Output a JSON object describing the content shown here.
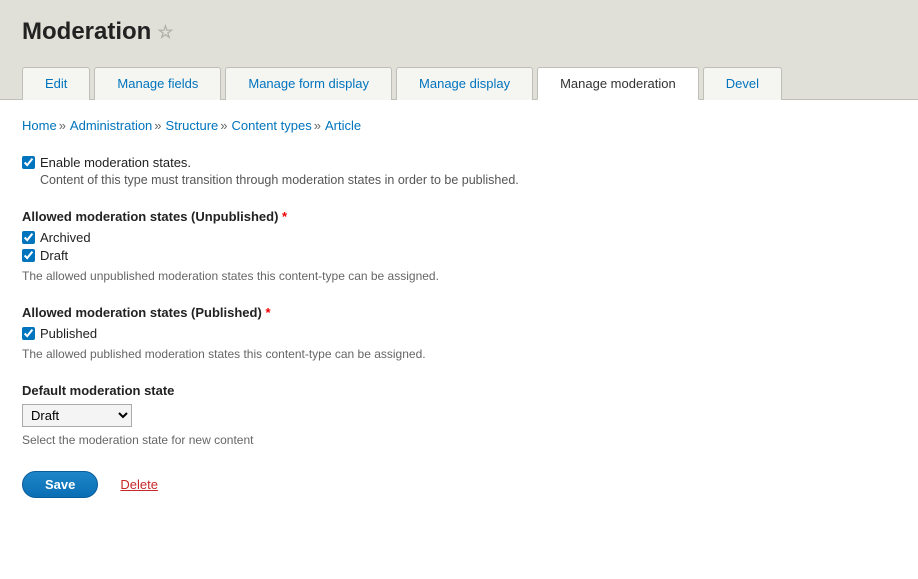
{
  "page_title": "Moderation",
  "tabs": [
    {
      "label": "Edit",
      "active": false
    },
    {
      "label": "Manage fields",
      "active": false
    },
    {
      "label": "Manage form display",
      "active": false
    },
    {
      "label": "Manage display",
      "active": false
    },
    {
      "label": "Manage moderation",
      "active": true
    },
    {
      "label": "Devel",
      "active": false
    }
  ],
  "breadcrumb": [
    "Home",
    "Administration",
    "Structure",
    "Content types",
    "Article"
  ],
  "enable_moderation": {
    "label": "Enable moderation states.",
    "checked": true,
    "description": "Content of this type must transition through moderation states in order to be published."
  },
  "unpublished": {
    "legend": "Allowed moderation states (Unpublished)",
    "required": "*",
    "options": [
      {
        "label": "Archived",
        "checked": true
      },
      {
        "label": "Draft",
        "checked": true
      }
    ],
    "help": "The allowed unpublished moderation states this content-type can be assigned."
  },
  "published": {
    "legend": "Allowed moderation states (Published)",
    "required": "*",
    "options": [
      {
        "label": "Published",
        "checked": true
      }
    ],
    "help": "The allowed published moderation states this content-type can be assigned."
  },
  "default_state": {
    "legend": "Default moderation state",
    "value": "Draft",
    "help": "Select the moderation state for new content"
  },
  "actions": {
    "save": "Save",
    "delete": "Delete"
  }
}
